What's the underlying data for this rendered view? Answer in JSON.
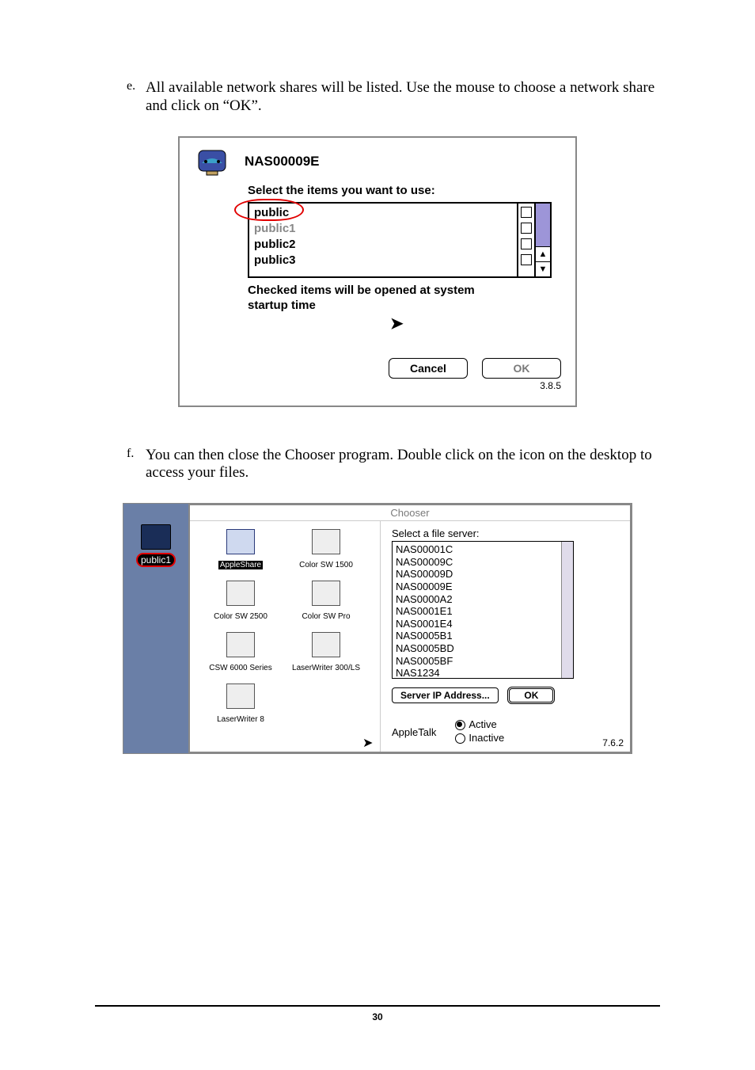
{
  "paragraphs": {
    "e_bullet": "e.",
    "e_text": "All available network shares will be listed.  Use the mouse to choose a network share and click on “OK”.",
    "f_bullet": "f.",
    "f_text": "You can then close the Chooser program. Double click on the icon on the desktop to access your files."
  },
  "shot1": {
    "title": "NAS00009E",
    "subtitle": "Select the items you want to use:",
    "shares": [
      "public",
      "public1",
      "public2",
      "public3"
    ],
    "note_line1": "Checked items will be opened at system",
    "note_line2": "startup time",
    "cancel": "Cancel",
    "ok": "OK",
    "version": "3.8.5"
  },
  "desk": {
    "label": "public1"
  },
  "chooser": {
    "title": "Chooser",
    "icons": [
      {
        "label": "AppleShare",
        "selected": true
      },
      {
        "label": "Color SW 1500",
        "selected": false
      },
      {
        "label": "Color SW 2500",
        "selected": false
      },
      {
        "label": "Color SW Pro",
        "selected": false
      },
      {
        "label": "CSW 6000 Series",
        "selected": false
      },
      {
        "label": "LaserWriter 300/LS",
        "selected": false
      },
      {
        "label": "LaserWriter 8",
        "selected": false
      }
    ],
    "server_label": "Select a file server:",
    "servers": [
      "NAS00001C",
      "NAS00009C",
      "NAS00009D",
      "NAS00009E",
      "NAS0000A2",
      "NAS0001E1",
      "NAS0001E4",
      "NAS0005B1",
      "NAS0005BD",
      "NAS0005BF",
      "NAS1234"
    ],
    "ip_button": "Server IP Address...",
    "ok": "OK",
    "appletalk": "AppleTalk",
    "active": "Active",
    "inactive": "Inactive",
    "version": "7.6.2"
  },
  "page_number": "30"
}
